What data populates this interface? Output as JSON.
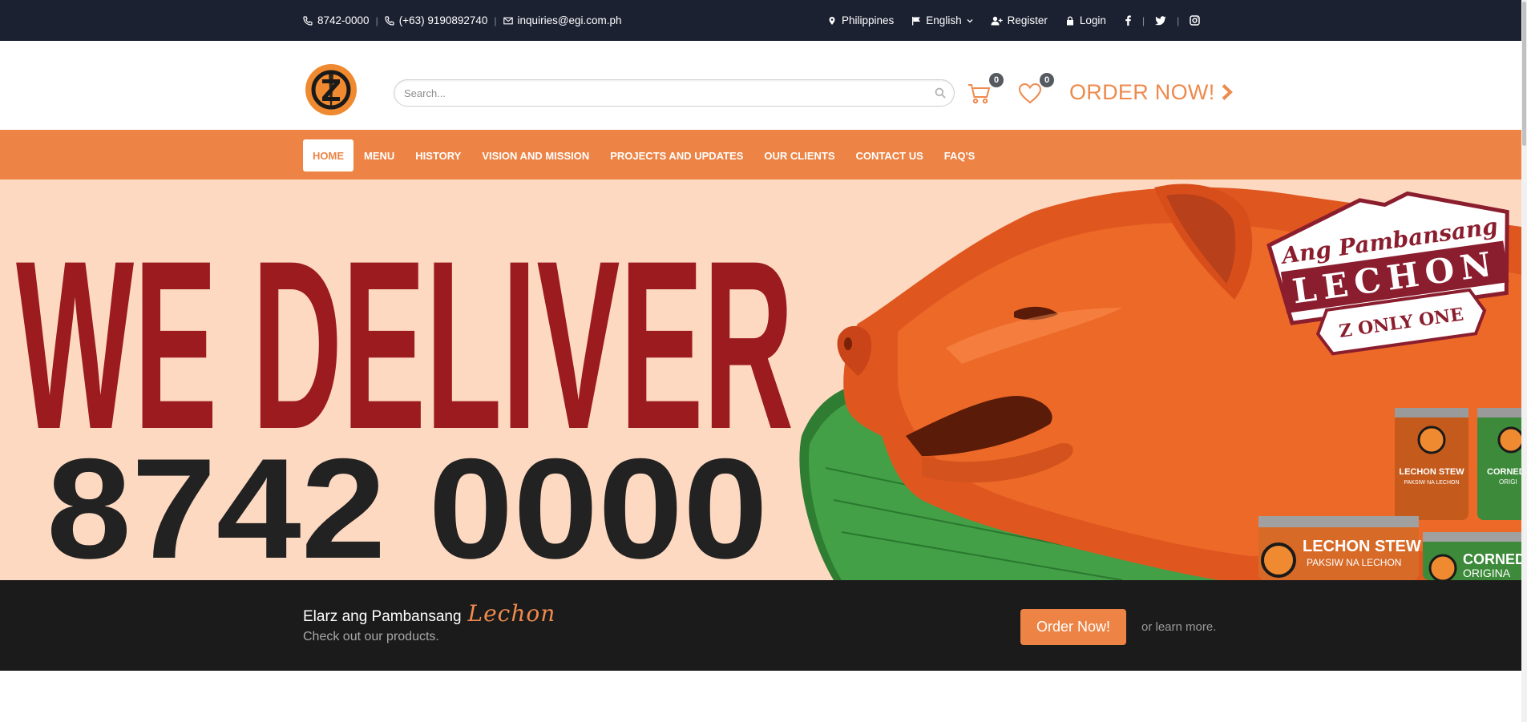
{
  "topbar": {
    "phone1": "8742-0000",
    "phone2": "(+63) 9190892740",
    "email": "inquiries@egi.com.ph",
    "country": "Philippines",
    "language": "English",
    "register": "Register",
    "login": "Login",
    "social": [
      "facebook-icon",
      "twitter-icon",
      "instagram-icon"
    ]
  },
  "header": {
    "logo_letter": "Z",
    "search_placeholder": "Search...",
    "cart_count": "0",
    "wishlist_count": "0",
    "order_now": "ORDER NOW!"
  },
  "nav": {
    "items": [
      {
        "label": "HOME",
        "active": true
      },
      {
        "label": "MENU"
      },
      {
        "label": "HISTORY"
      },
      {
        "label": "VISION AND MISSION"
      },
      {
        "label": "PROJECTS AND UPDATES"
      },
      {
        "label": "OUR CLIENTS"
      },
      {
        "label": "CONTACT US"
      },
      {
        "label": "FAQ'S"
      }
    ]
  },
  "hero": {
    "headline": "WE DELIVER",
    "number": "8742 0000",
    "badge_top": "Ang Pambansang",
    "badge_main": "LECHON",
    "badge_ribbon": "Z ONLY ONE",
    "can1_title": "LECHON STEW",
    "can1_sub": "PAKSIW NA LECHON",
    "can2_title": "CORNED",
    "can2_sub": "ORIGINA",
    "can3_title": "LECHON STEW",
    "can3_sub": "PAKSIW NA LECHON",
    "can4_title": "CORNED L",
    "can4_sub": "ORIGI"
  },
  "cta": {
    "title": "Elarz ang Pambansang",
    "title_script": "Lechon",
    "subtitle": "Check out our products.",
    "button": "Order Now!",
    "learn_more": "or learn more."
  },
  "colors": {
    "topbar": "#1c2132",
    "accent": "#ed8445",
    "hero_bg": "#fed9c1",
    "headline_red": "#9b1b1e",
    "cta_bg": "#1b1b1b"
  }
}
